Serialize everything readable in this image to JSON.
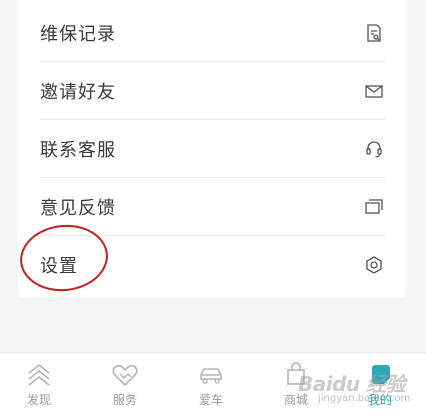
{
  "menu": {
    "items": [
      {
        "label": "维保记录",
        "icon": "maintenance-record-icon"
      },
      {
        "label": "邀请好友",
        "icon": "envelope-icon"
      },
      {
        "label": "联系客服",
        "icon": "headset-icon"
      },
      {
        "label": "意见反馈",
        "icon": "feedback-icon"
      },
      {
        "label": "设置",
        "icon": "settings-hexagon-icon"
      }
    ]
  },
  "tabbar": {
    "tabs": [
      {
        "label": "发现",
        "icon": "discover-chevron-icon",
        "active": false
      },
      {
        "label": "服务",
        "icon": "service-handshake-icon",
        "active": false
      },
      {
        "label": "爱车",
        "icon": "car-icon",
        "active": false
      },
      {
        "label": "商城",
        "icon": "shopping-bag-icon",
        "active": false
      },
      {
        "label": "我的",
        "icon": "profile-icon",
        "active": true
      }
    ]
  },
  "watermark": {
    "brand": "Baidu 经验",
    "url": "jingyan.baidu.com"
  },
  "colors": {
    "accent": "#2aa7b8",
    "highlight_circle": "#c41e1e",
    "text": "#3a3a3a",
    "icon": "#555555"
  }
}
